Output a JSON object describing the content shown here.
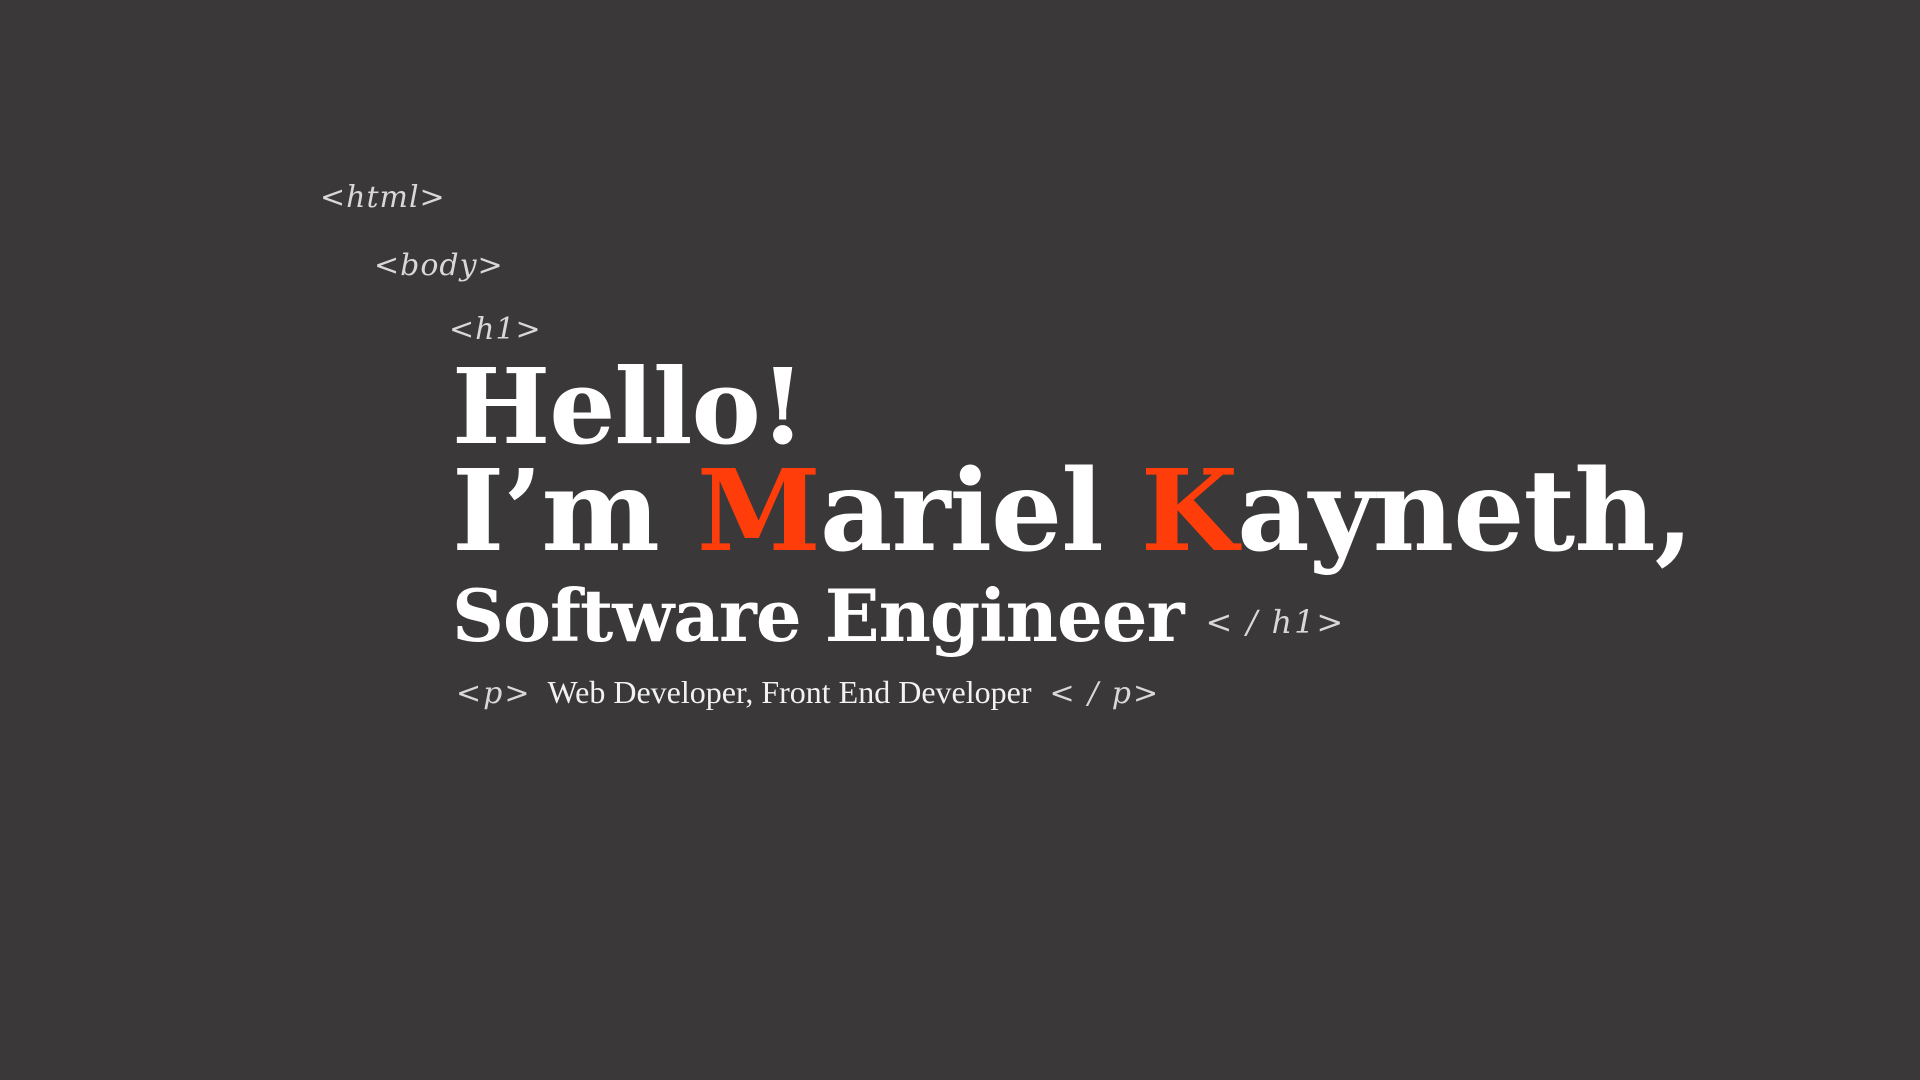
{
  "colors": {
    "background": "#3a3839",
    "text": "#ffffff",
    "accent": "#ff3d0a",
    "tag_text": "#d8d8d8"
  },
  "code_tags": {
    "html_open": "<html>",
    "body_open": "<body>",
    "h1_open": "<h1>",
    "h1_close": "< / h1>",
    "p_open": "<p>",
    "p_close": "< / p>"
  },
  "hero": {
    "greeting": "Hello!",
    "name_prefix": "I’m ",
    "first_initial": "M",
    "first_rest": "ariel ",
    "last_initial": "K",
    "last_rest": "ayneth,",
    "role": "Software Engineer",
    "subtitle": "Web Developer, Front End Developer"
  }
}
